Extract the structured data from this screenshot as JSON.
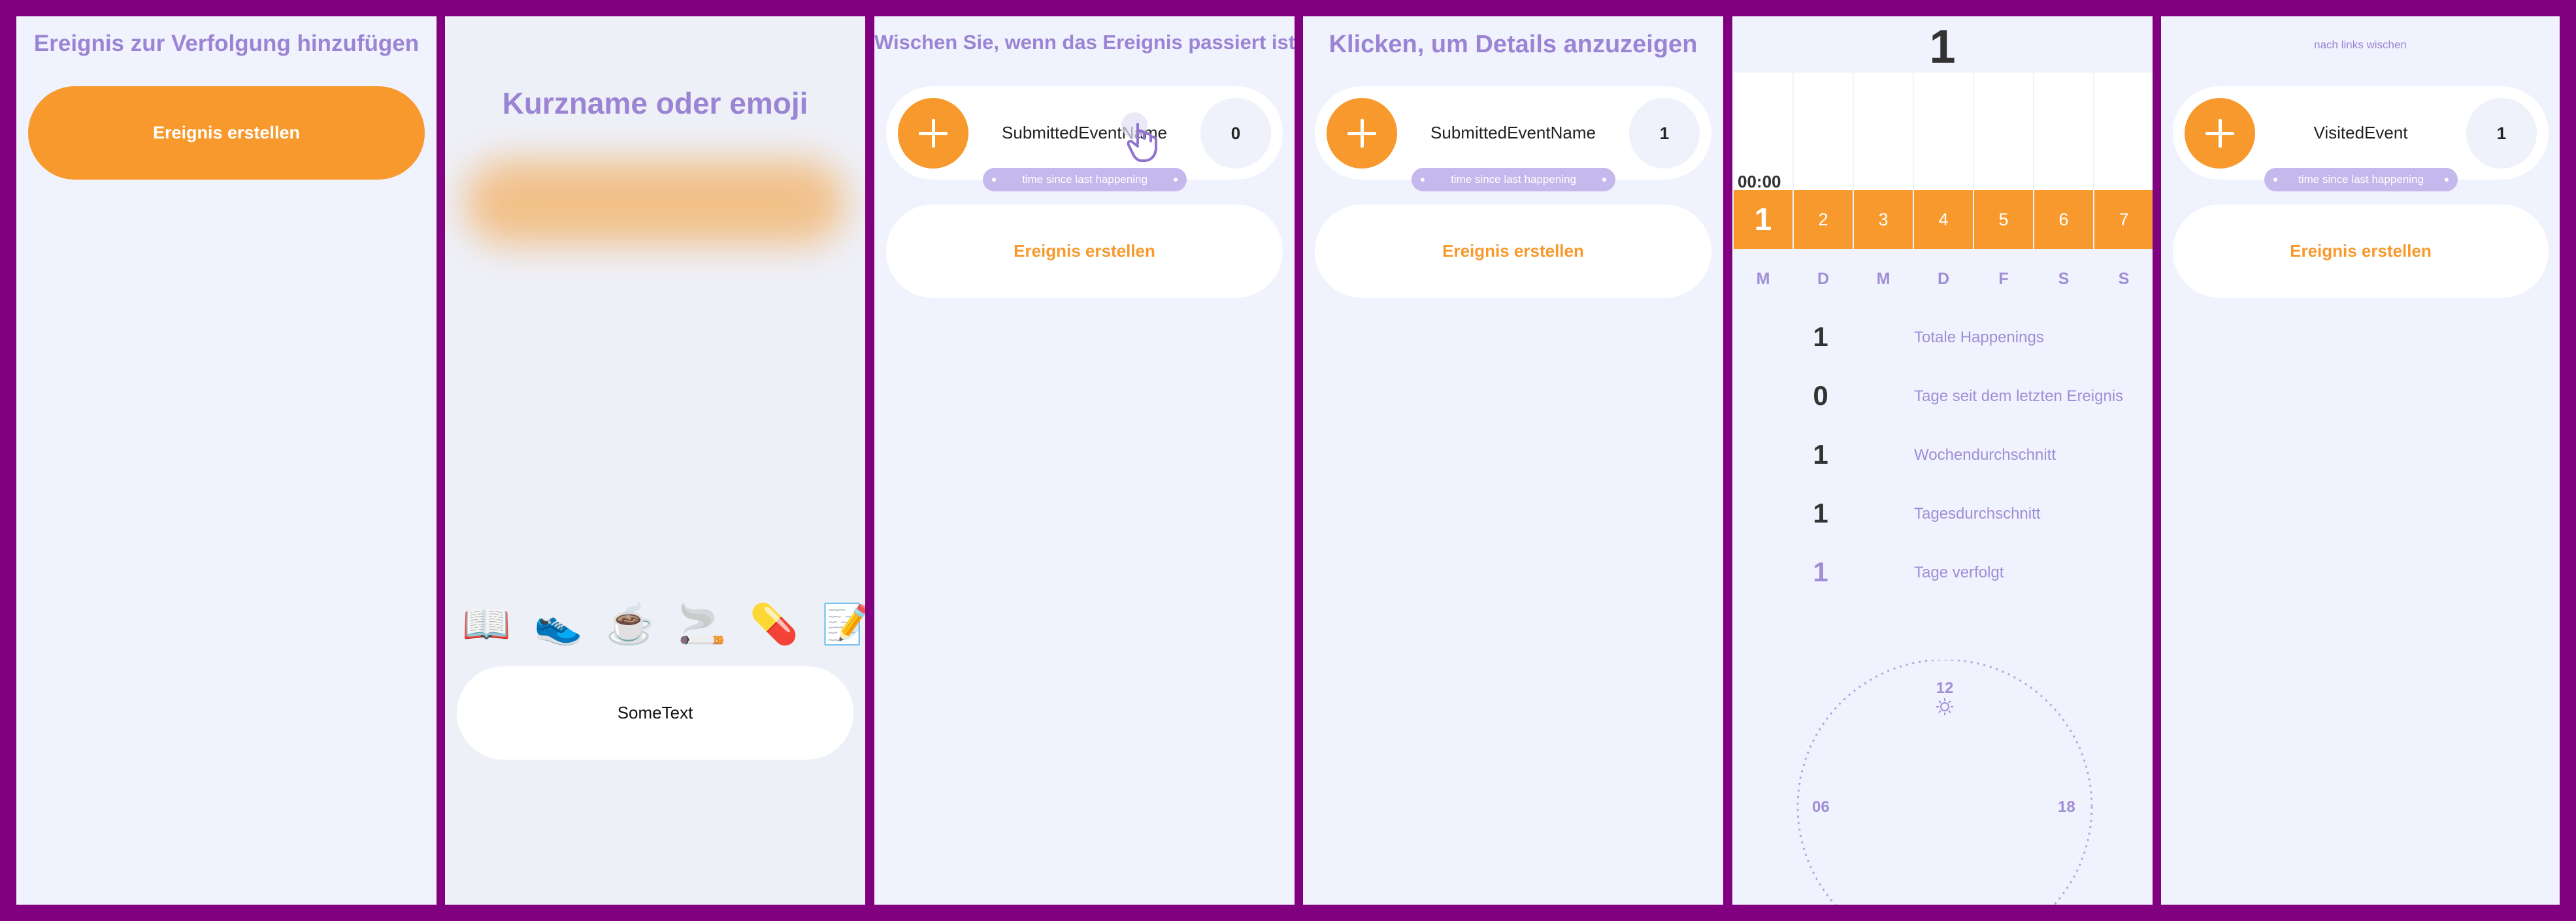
{
  "screen1": {
    "title": "Ereignis zur Verfolgung hinzufügen",
    "create_button": "Ereignis erstellen"
  },
  "screen2": {
    "title": "Kurzname oder emoji",
    "emojis": [
      "📖",
      "👟",
      "☕",
      "🚬",
      "💊",
      "📝"
    ],
    "text_value": "SomeText"
  },
  "screen3": {
    "title": "Wischen Sie, wenn das Ereignis passiert ist",
    "event_name": "SubmittedEventName",
    "event_count": "0",
    "time_since": "time since last happening",
    "create_button": "Ereignis erstellen",
    "gesture_icon": "swipe-hand-icon"
  },
  "screen4": {
    "title": "Klicken, um Details anzuzeigen",
    "event_name": "SubmittedEventName",
    "event_count": "1",
    "time_since": "time since last happening",
    "create_button": "Ereignis erstellen"
  },
  "screen5": {
    "total_count": "1",
    "time_label": "00:00",
    "day_numbers": [
      "1",
      "2",
      "3",
      "4",
      "5",
      "6",
      "7"
    ],
    "day_letters": [
      "M",
      "D",
      "M",
      "D",
      "F",
      "S",
      "S"
    ],
    "stats": [
      {
        "value": "1",
        "label": "Totale Happenings"
      },
      {
        "value": "0",
        "label": "Tage seit dem letzten Ereignis"
      },
      {
        "value": "1",
        "label": "Wochendurchschnitt"
      },
      {
        "value": "1",
        "label": "Tagesdurchschnitt"
      },
      {
        "value": "1",
        "label": "Tage verfolgt"
      }
    ],
    "clock": {
      "top": "12",
      "left": "06",
      "right": "18",
      "sun_icon": "sun-icon"
    }
  },
  "screen6": {
    "hint": "nach links wischen",
    "event_name": "VisitedEvent",
    "event_count": "1",
    "time_since": "time since last happening",
    "create_button": "Ereignis erstellen"
  },
  "colors": {
    "background": "#800080",
    "panel": "#f0f2fd",
    "accent": "#f7992c",
    "title": "#9b84d3",
    "chip": "#c4b8ec"
  }
}
